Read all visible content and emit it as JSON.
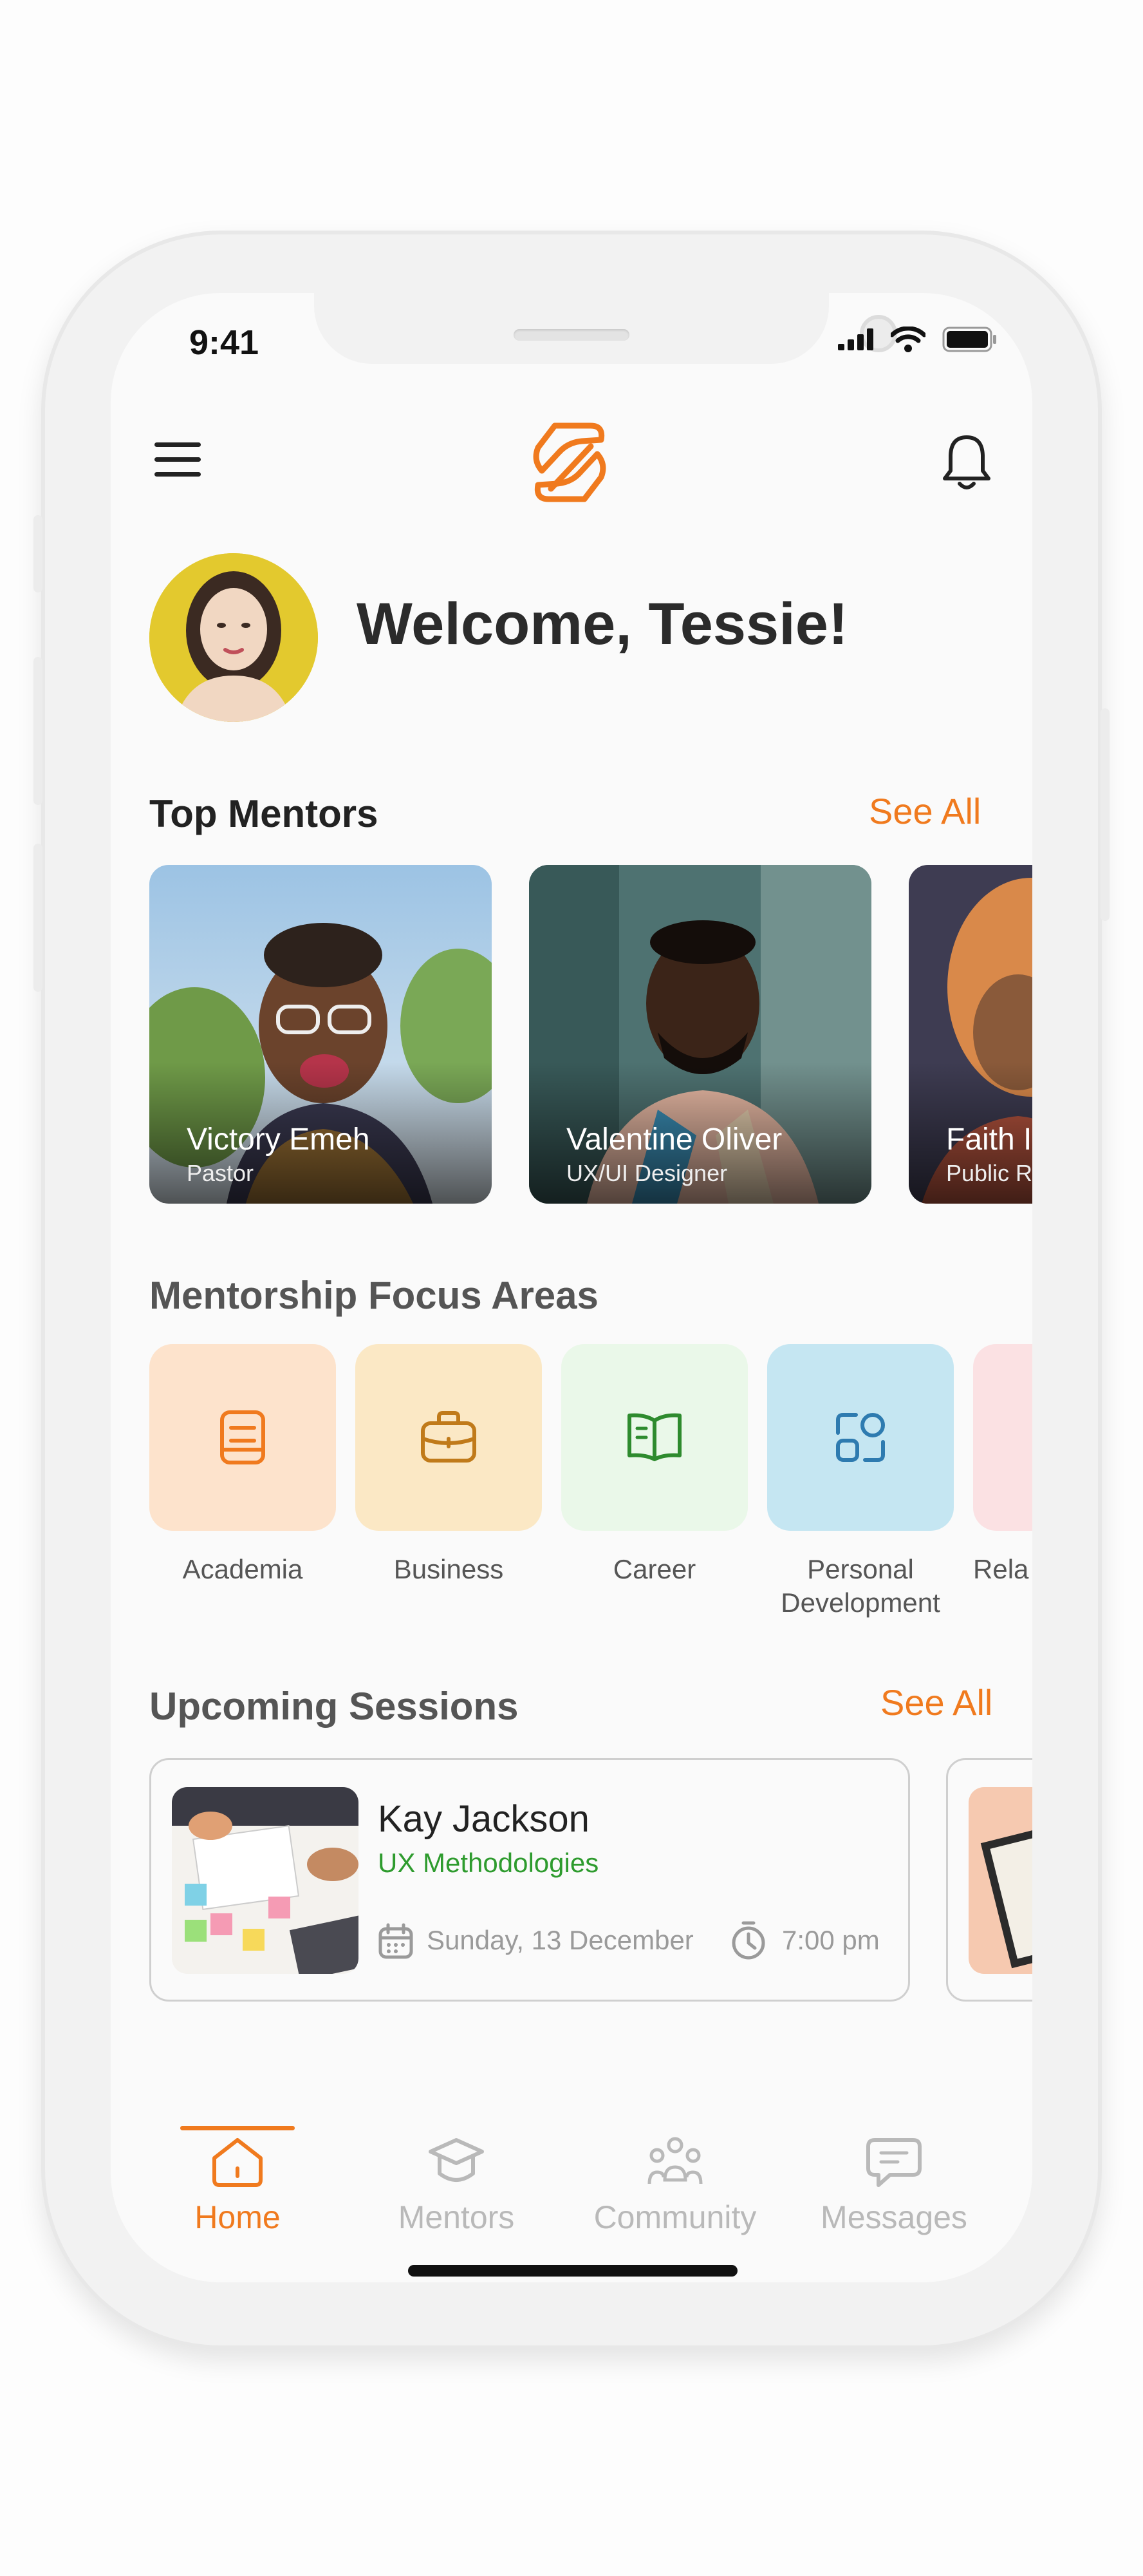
{
  "status_bar": {
    "time": "9:41"
  },
  "header": {
    "menu_icon": "hamburger-icon",
    "logo_icon": "s-logo-icon",
    "notification_icon": "bell-icon",
    "brand_color": "#f07a1e"
  },
  "welcome": {
    "text": "Welcome, Tessie!"
  },
  "top_mentors": {
    "title": "Top Mentors",
    "see_all": "See All",
    "mentors": [
      {
        "name": "Victory Emeh",
        "role": "Pastor"
      },
      {
        "name": "Valentine Oliver",
        "role": "UX/UI Designer"
      },
      {
        "name": "Faith I",
        "role": "Public R"
      }
    ]
  },
  "focus_areas": {
    "title": "Mentorship Focus Areas",
    "items": [
      {
        "label": "Academia",
        "icon": "document-icon",
        "color": "#fde3cc"
      },
      {
        "label": "Business",
        "icon": "briefcase-icon",
        "color": "#fbe8c5"
      },
      {
        "label": "Career",
        "icon": "open-book-icon",
        "color": "#eaf8e9"
      },
      {
        "label": "Personal Development",
        "icon": "apps-icon",
        "color": "#c5e6f2"
      },
      {
        "label": "Rela",
        "icon": "",
        "color": "#fbe1e3"
      }
    ]
  },
  "upcoming_sessions": {
    "title": "Upcoming Sessions",
    "see_all": "See All",
    "sessions": [
      {
        "mentor": "Kay Jackson",
        "topic": "UX Methodologies",
        "date": "Sunday, 13 December",
        "time": "7:00 pm",
        "topic_color": "#2e9b2e"
      }
    ]
  },
  "bottom_nav": {
    "items": [
      {
        "label": "Home",
        "icon": "home-icon",
        "active": true
      },
      {
        "label": "Mentors",
        "icon": "graduation-cap-icon",
        "active": false
      },
      {
        "label": "Community",
        "icon": "community-icon",
        "active": false
      },
      {
        "label": "Messages",
        "icon": "message-icon",
        "active": false
      }
    ]
  }
}
